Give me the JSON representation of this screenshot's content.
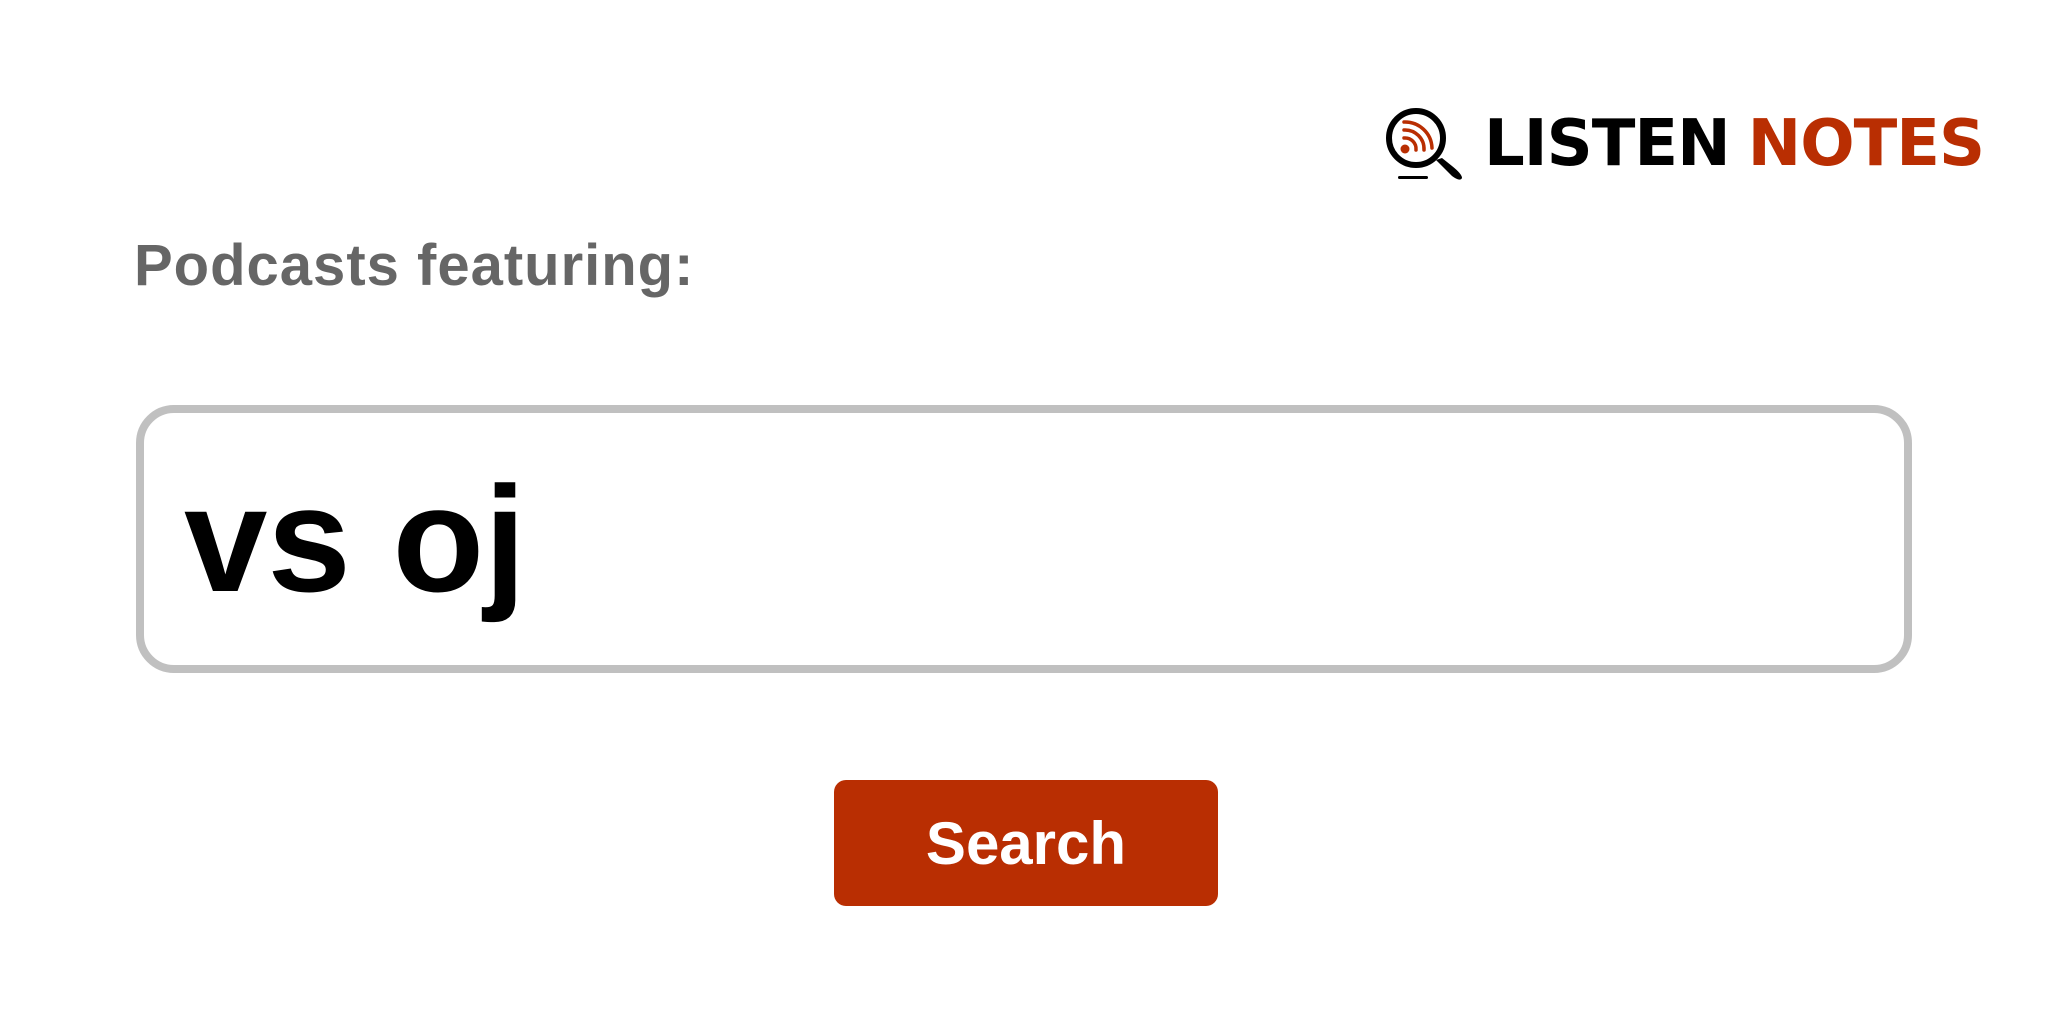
{
  "logo": {
    "word1": "LISTEN",
    "word2": "NOTES",
    "icon": "search-podcast-icon",
    "colors": {
      "primary": "#000000",
      "accent": "#b92e02"
    }
  },
  "heading": "Podcasts featuring:",
  "search": {
    "value": "vs oj",
    "placeholder": ""
  },
  "button": {
    "label": "Search",
    "color": "#b92e02"
  }
}
